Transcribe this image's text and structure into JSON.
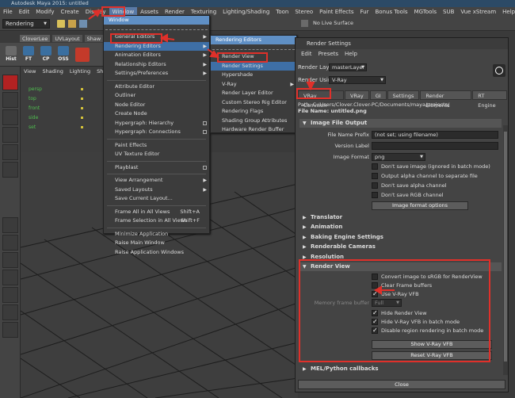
{
  "app": {
    "title": "Autodesk Maya 2015: untitled"
  },
  "menubar": [
    "File",
    "Edit",
    "Modify",
    "Create",
    "Display",
    "Window",
    "Assets",
    "Render",
    "Texturing",
    "Lighting/Shading",
    "Toon",
    "Stereo",
    "Paint Effects",
    "Fur",
    "Bonus Tools",
    "MGTools",
    "SUB",
    "Vue xStream",
    "Help"
  ],
  "statusline": {
    "mode": "Rendering",
    "render_option": "No Live Surface"
  },
  "shelf": {
    "tabs": [
      "CloverLee",
      "UVLayout",
      "Shaw"
    ],
    "buttons": [
      {
        "label": "Hist",
        "icon": "history-icon"
      },
      {
        "label": "FT",
        "icon": "freeze-transform-icon"
      },
      {
        "label": "CP",
        "icon": "center-pivot-icon"
      },
      {
        "label": "OSS",
        "icon": "oss-icon"
      }
    ]
  },
  "panel_menu": [
    "View",
    "Shading",
    "Lighting",
    "Sh"
  ],
  "outliner": [
    "persp",
    "top",
    "front",
    "side",
    "set"
  ],
  "window_menu": {
    "items": [
      {
        "label": "General Editors",
        "sub": true
      },
      {
        "label": "Rendering Editors",
        "sub": true,
        "hi": true
      },
      {
        "label": "Animation Editors",
        "sub": true
      },
      {
        "label": "Relationship Editors",
        "sub": true
      },
      {
        "label": "Settings/Preferences",
        "sub": true
      },
      {
        "sep": true
      },
      {
        "label": "Attribute Editor"
      },
      {
        "label": "Outliner"
      },
      {
        "label": "Node Editor"
      },
      {
        "label": "Create Node"
      },
      {
        "label": "Hypergraph: Hierarchy",
        "opt": true
      },
      {
        "label": "Hypergraph: Connections",
        "opt": true
      },
      {
        "sep": true
      },
      {
        "label": "Paint Effects"
      },
      {
        "label": "UV Texture Editor"
      },
      {
        "sep": true
      },
      {
        "label": "Playblast",
        "opt": true
      },
      {
        "sep": true
      },
      {
        "label": "View Arrangement",
        "sub": true
      },
      {
        "label": "Saved Layouts",
        "sub": true
      },
      {
        "label": "Save Current Layout..."
      },
      {
        "sep": true
      },
      {
        "label": "Frame All in All Views",
        "shortcut": "Shift+A"
      },
      {
        "label": "Frame Selection in All Views",
        "shortcut": "Shift+F"
      },
      {
        "sep": true
      },
      {
        "label": "Minimize Application"
      },
      {
        "label": "Raise Main Window"
      },
      {
        "label": "Raise Application Windows"
      }
    ],
    "header": "Window"
  },
  "render_editors_menu": {
    "header": "Rendering Editors",
    "items": [
      {
        "label": "Render View"
      },
      {
        "label": "Render Settings",
        "hi": true
      },
      {
        "label": "Hypershade"
      },
      {
        "label": "V-Ray",
        "sub": true
      },
      {
        "label": "Render Layer Editor"
      },
      {
        "label": "Custom Stereo Rig Editor"
      },
      {
        "label": "Rendering Flags"
      },
      {
        "label": "Shading Group Attributes"
      },
      {
        "label": "Hardware Render Buffer"
      }
    ]
  },
  "render_settings": {
    "title": "Render Settings",
    "menu": [
      "Edit",
      "Presets",
      "Help"
    ],
    "render_layer_label": "Render Layer",
    "render_layer_value": "masterLayer",
    "render_using_label": "Render Using",
    "render_using_value": "V-Ray",
    "tabs": [
      "VRay Common",
      "VRay",
      "GI",
      "Settings",
      "Render Elements",
      "RT Engine"
    ],
    "path": "Path: C:/Users/Clover.Clover-PC/Documents/maya/projects/",
    "file_name": "File Name: untitled.png",
    "image_file_output": "Image File Output",
    "file_name_prefix_label": "File Name Prefix",
    "file_name_prefix_value": "(not set; using filename)",
    "version_label_label": "Version Label",
    "version_label_value": "",
    "image_format_label": "Image Format",
    "image_format_value": "png",
    "output_checks": [
      {
        "label": "Don't save image (ignored in batch mode)",
        "checked": false
      },
      {
        "label": "Output alpha channel to separate file",
        "checked": false
      },
      {
        "label": "Don't save alpha channel",
        "checked": false
      },
      {
        "label": "Don't save RGB channel",
        "checked": false
      }
    ],
    "image_format_options": "Image format options",
    "collapsed_sections": [
      "Translator",
      "Animation",
      "Baking Engine Settings",
      "Renderable Cameras",
      "Resolution"
    ],
    "render_view": "Render View",
    "render_view_checks": [
      {
        "label": "Convert image to sRGB for RenderView",
        "checked": false
      },
      {
        "label": "Clear Frame buffers",
        "checked": false
      },
      {
        "label": "Use V-Ray VFB",
        "checked": true
      }
    ],
    "memory_frame_buffer_label": "Memory frame buffer",
    "memory_frame_buffer_value": "Full",
    "vfb_checks": [
      {
        "label": "Hide Render View",
        "checked": true
      },
      {
        "label": "Hide V-Ray VFB in batch mode",
        "checked": true
      },
      {
        "label": "Disable region rendering in batch mode",
        "checked": true
      }
    ],
    "show_vfb": "Show V-Ray VFB",
    "reset_vfb": "Reset V-Ray VFB",
    "mel_section": "MEL/Python callbacks",
    "close": "Close"
  },
  "colors": {
    "highlight": "#3e6fa6",
    "annotation": "#e0302a",
    "outliner_text": "#4fbf4f"
  }
}
